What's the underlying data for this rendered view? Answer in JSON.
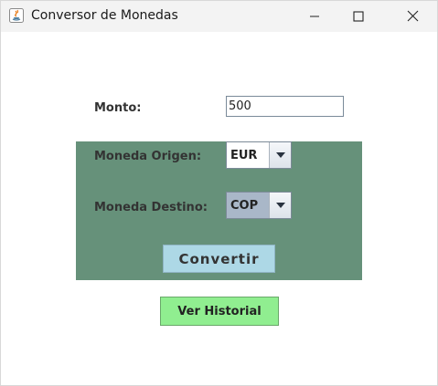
{
  "window": {
    "title": "Conversor de Monedas",
    "controls": [
      "minimize-icon",
      "maximize-icon",
      "close-icon"
    ]
  },
  "form": {
    "amount_label": "Monto:",
    "amount_value": "500",
    "origin_label": "Moneda Origen:",
    "origin_value": "EUR",
    "destination_label": "Moneda Destino:",
    "destination_value": "COP",
    "convert_button": "Convertir",
    "history_button": "Ver Historial"
  },
  "colors": {
    "panel": "#66917a",
    "convert_button": "#add8e6",
    "history_button": "#90ee90"
  }
}
